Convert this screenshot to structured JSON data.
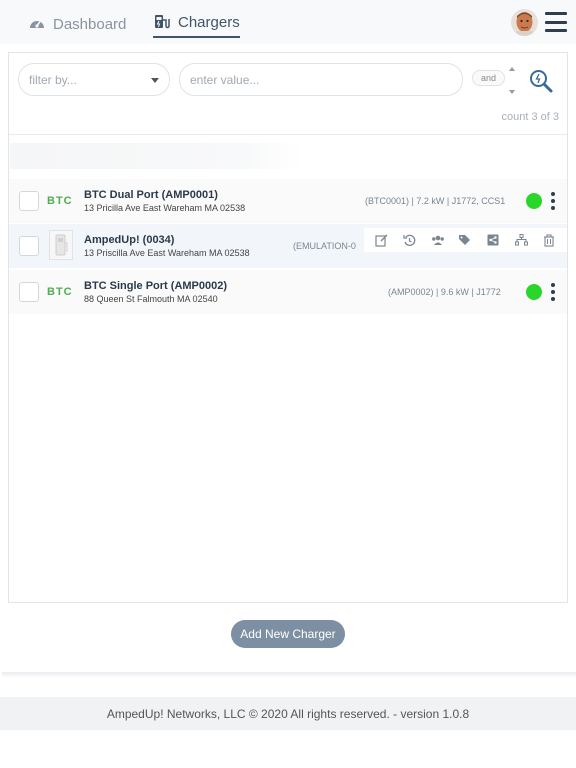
{
  "nav": {
    "tabs": [
      {
        "label": "Dashboard",
        "icon": "gauge-icon",
        "active": false
      },
      {
        "label": "Chargers",
        "icon": "charger-icon",
        "active": true
      }
    ],
    "avatar": "user-avatar",
    "menu_icon": "hamburger-icon"
  },
  "filter": {
    "select_placeholder": "filter by...",
    "value_placeholder": "enter value...",
    "logic_label": "and",
    "search_icon": "search-zoom-icon"
  },
  "count_label": "count 3 of 3",
  "chargers": [
    {
      "logo": "BTC",
      "name": "BTC Dual Port (AMP0001)",
      "address": "13 Pricilla Ave East Wareham MA 02538",
      "details": "(BTC0001) | 7.2 kW | J1772, CCS1",
      "status_color": "#2bd62b"
    },
    {
      "logo": "",
      "name": "AmpedUp! (0034)",
      "address": "13 Priscilla Ave East Wareham MA 02538",
      "details": "(EMULATION-0",
      "actions": [
        "edit-icon",
        "history-icon",
        "users-icon",
        "tags-icon",
        "share-icon",
        "network-icon",
        "trash-icon"
      ]
    },
    {
      "logo": "BTC",
      "name": "BTC Single Port (AMP0002)",
      "address": "88 Queen St Falmouth MA 02540",
      "details": "(AMP0002) | 9.6 kW | J1772",
      "status_color": "#2bd62b"
    }
  ],
  "add_button_label": "Add New Charger",
  "footer_text": "AmpedUp! Networks, LLC © 2020 All rights reserved. - version 1.0.8",
  "colors": {
    "accent": "#40546a",
    "status_ok": "#2bd62b",
    "brand_green": "#4caf50",
    "button": "#7d8fa3"
  }
}
